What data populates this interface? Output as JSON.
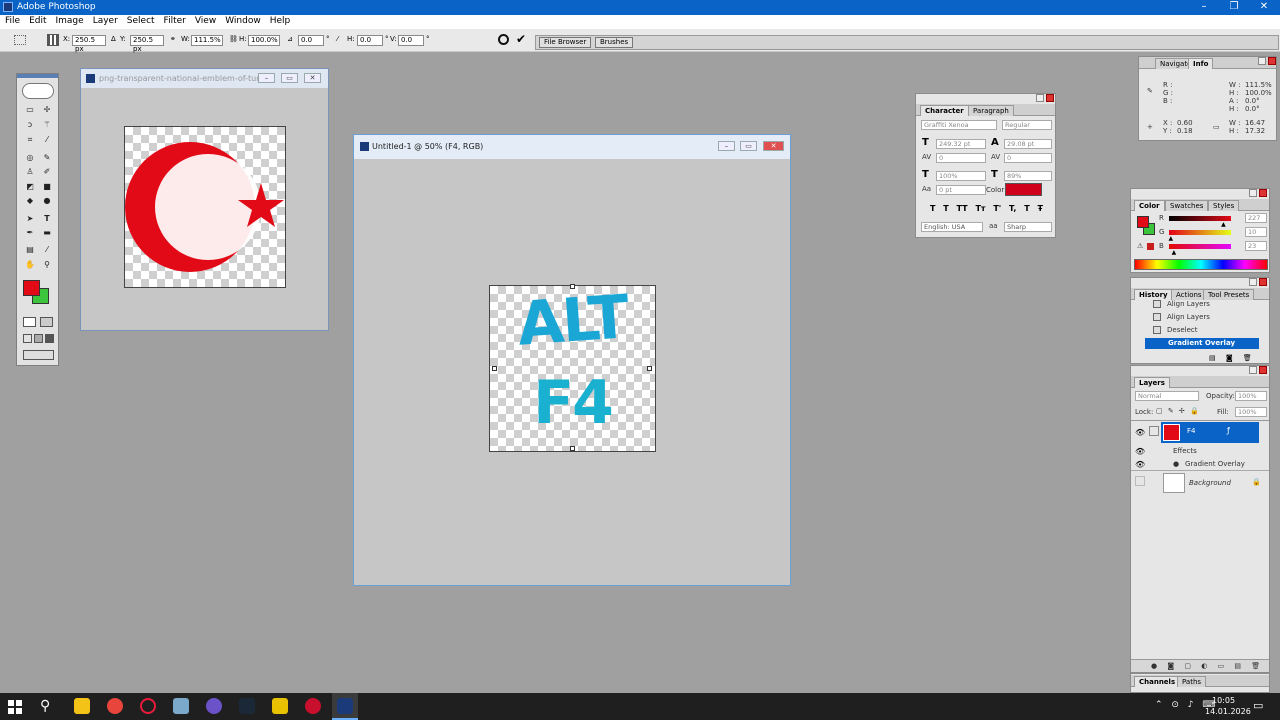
{
  "app": {
    "title": "Adobe Photoshop"
  },
  "menu": [
    "File",
    "Edit",
    "Image",
    "Layer",
    "Select",
    "Filter",
    "View",
    "Window",
    "Help"
  ],
  "options": {
    "x_label": "X:",
    "x_value": "250.5 px",
    "y_label": "Y:",
    "y_value": "250.5 px",
    "w_label": "W:",
    "w_value": "111.5%",
    "h_label": "H:",
    "h_value": "100.0%",
    "rot_value": "0.0",
    "hskew_label": "H:",
    "hskew_value": "0.0",
    "vskew_label": "V:",
    "vskew_value": "0.0",
    "file_browser": "File Browser",
    "brushes": "Brushes"
  },
  "doc1": {
    "title": "png-transparent-national-emblem-of-tur..."
  },
  "doc2": {
    "title": "Untitled-1 @ 50% (F4, RGB)"
  },
  "canvas_text": {
    "line1": "ALT",
    "line2": "F4"
  },
  "info": {
    "tabs": [
      "Navigator",
      "Info"
    ],
    "r": "R :",
    "g": "G :",
    "b": "B :",
    "w_label": "W :",
    "w": "111.5%",
    "h_label": "H :",
    "h": "100.0%",
    "a_label": "A :",
    "a": "0.0°",
    "h2_label": "H :",
    "h2": "0.0°",
    "x_label": "X :",
    "x": "0.60",
    "y_label": "Y :",
    "y": "0.18",
    "w2_label": "W :",
    "w2": "16.47",
    "h3_label": "H :",
    "h3": "17.32"
  },
  "character": {
    "tabs": [
      "Character",
      "Paragraph"
    ],
    "font": "Graffiti Xenoa",
    "style": "Regular",
    "size": "249.32 pt",
    "leading": "29.08 pt",
    "kerning": "0",
    "tracking": "0",
    "vscale": "100%",
    "hscale": "89%",
    "baseline": "0 pt",
    "color_label": "Color:",
    "color": "#d0021b",
    "styles": [
      "T",
      "T",
      "TT",
      "Tт",
      "T'",
      "T,",
      "T",
      "Ŧ"
    ],
    "language": "English: USA",
    "antialias_prefix": "aa",
    "antialias": "Sharp"
  },
  "color_panel": {
    "tabs": [
      "Color",
      "Swatches",
      "Styles"
    ],
    "r_label": "R",
    "r": "227",
    "g_label": "G",
    "g": "10",
    "b_label": "B",
    "b": "23",
    "r_level": 0.89,
    "g_level": 0.04,
    "b_level": 0.09
  },
  "history": {
    "tabs": [
      "History",
      "Actions",
      "Tool Presets"
    ],
    "items": [
      "Align Layers",
      "Align Layers",
      "Deselect",
      "Gradient Overlay"
    ]
  },
  "layers": {
    "tabs": [
      "Layers"
    ],
    "blend": "Normal",
    "opacity_label": "Opacity:",
    "opacity": "100%",
    "lock_label": "Lock:",
    "fill_label": "Fill:",
    "fill": "100%",
    "layer_name": "F4",
    "effects": "Effects",
    "effect": "Gradient Overlay",
    "background": "Background"
  },
  "bottom_tabs": [
    "Channels",
    "Paths"
  ],
  "clock": {
    "time": "10:05",
    "date": "14.01.2026"
  },
  "colors": {
    "fg": "#e30a17",
    "bg": "#3cc43c",
    "accent": "#0a64c8",
    "text_blue": "#1aa7d6"
  }
}
